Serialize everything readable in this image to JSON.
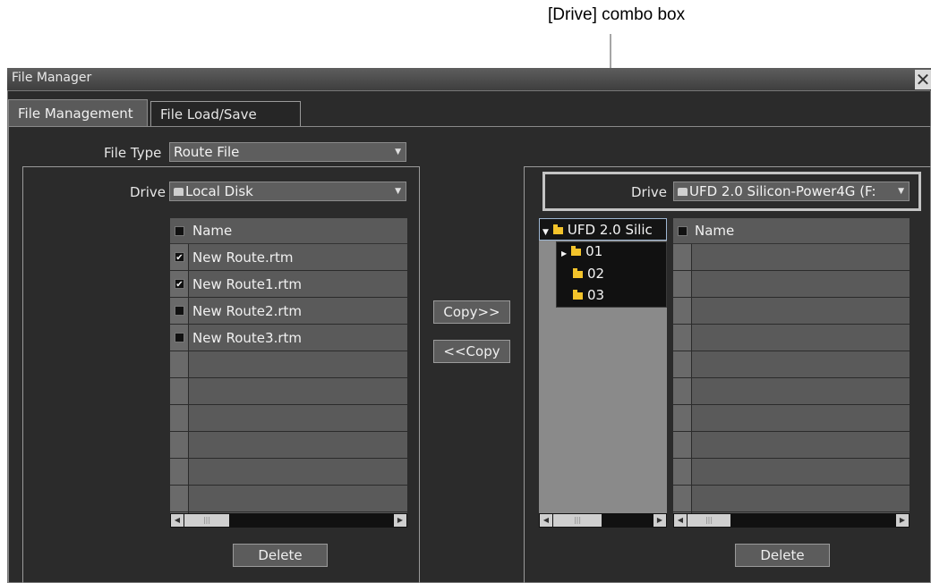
{
  "annotation": {
    "label": "[Drive] combo box"
  },
  "window": {
    "title": "File Manager",
    "close_glyph": "✕"
  },
  "tabs": [
    {
      "label": "File Management",
      "active": true
    },
    {
      "label": "File Load/Save",
      "active": false
    }
  ],
  "file_type": {
    "label": "File Type",
    "value": "Route File"
  },
  "left_panel": {
    "drive_label": "Drive",
    "drive_value": "Local Disk",
    "drive_icon": "disk-icon",
    "column_header": "Name",
    "files": [
      {
        "name": "New Route.rtm",
        "checked": true
      },
      {
        "name": "New Route1.rtm",
        "checked": true
      },
      {
        "name": "New Route2.rtm",
        "checked": false
      },
      {
        "name": "New Route3.rtm",
        "checked": false
      }
    ],
    "delete_label": "Delete"
  },
  "copy_buttons": {
    "copy_right": "Copy>>",
    "copy_left": "<<Copy"
  },
  "right_panel": {
    "drive_label": "Drive",
    "drive_value": "UFD 2.0 Silicon-Power4G (F:",
    "tree": {
      "root": "UFD 2.0 Silic",
      "children": [
        "01",
        "02",
        "03"
      ]
    },
    "column_header": "Name",
    "delete_label": "Delete"
  },
  "colors": {
    "window_bg": "#2b2b2b",
    "panel_bg": "#5a5a5a",
    "folder": "#f3c32b",
    "highlight": "#c4c4c4"
  }
}
